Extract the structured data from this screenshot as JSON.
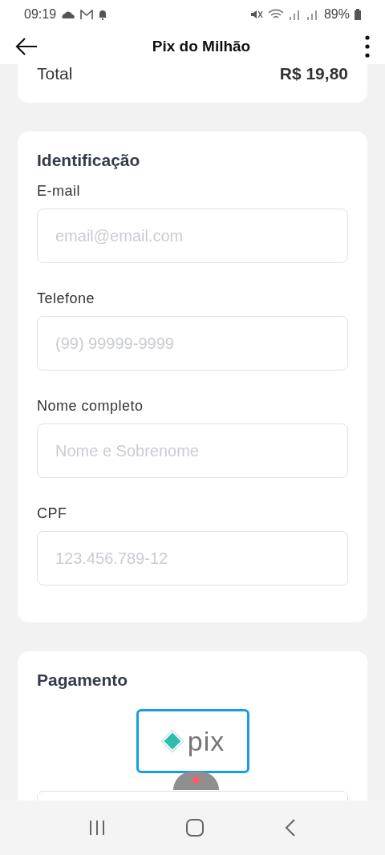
{
  "status_bar": {
    "time": "09:19",
    "battery": "89%"
  },
  "app_bar": {
    "title": "Pix do Milhão"
  },
  "summary": {
    "label": "Total",
    "value": "R$ 19,80"
  },
  "identification": {
    "title": "Identificação",
    "fields": [
      {
        "label": "E-mail",
        "placeholder": "email@email.com"
      },
      {
        "label": "Telefone",
        "placeholder": "(99) 99999-9999"
      },
      {
        "label": "Nome completo",
        "placeholder": "Nome e Sobrenome"
      },
      {
        "label": "CPF",
        "placeholder": "123.456.789-12"
      }
    ]
  },
  "payment": {
    "title": "Pagamento",
    "methods": [
      {
        "label": "pix",
        "selected": true
      }
    ]
  }
}
